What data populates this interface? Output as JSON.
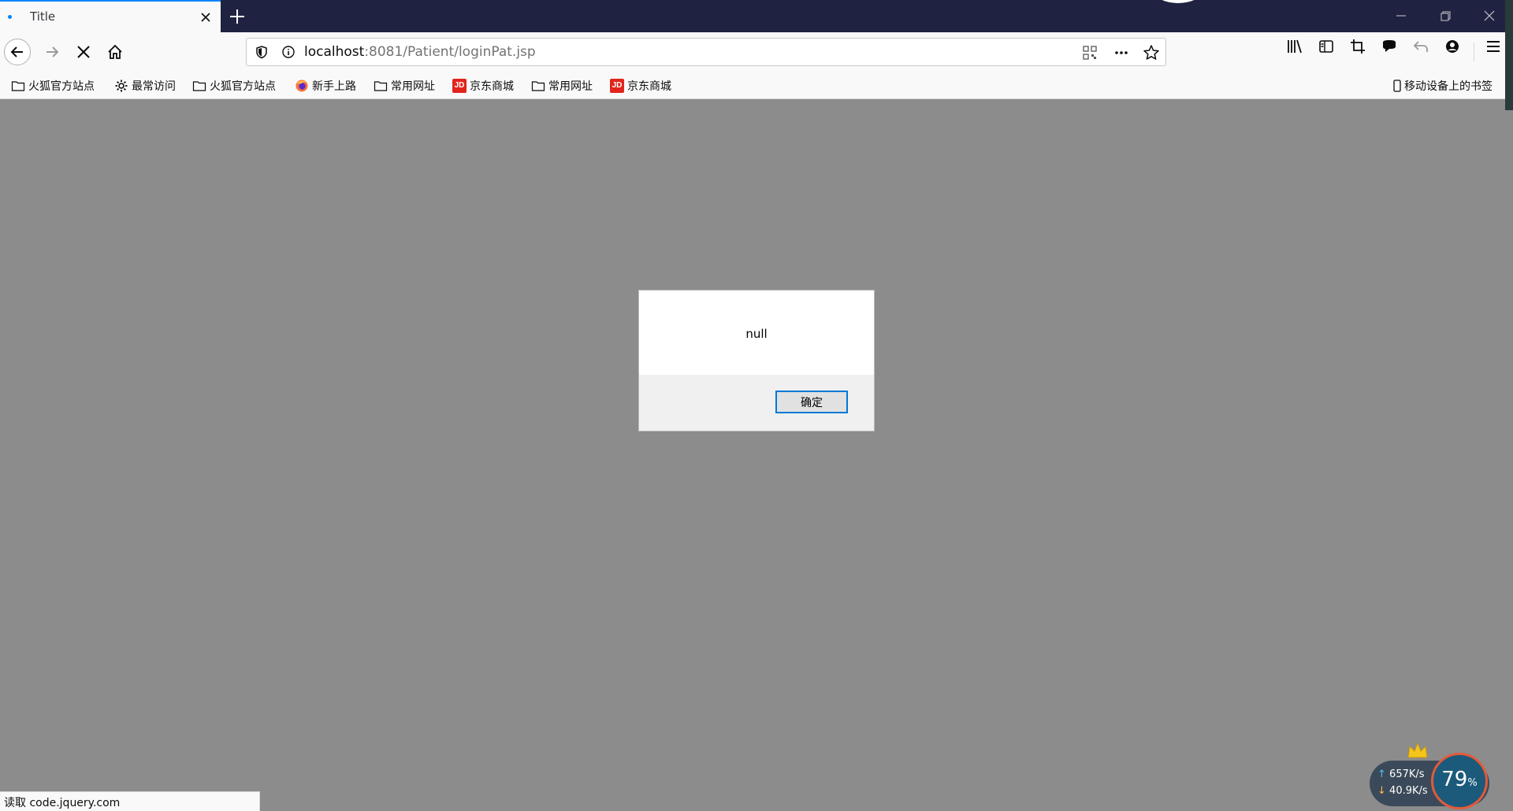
{
  "tab": {
    "title": "Title"
  },
  "urlbar": {
    "host": "localhost",
    "rest": ":8081/Patient/loginPat.jsp"
  },
  "bookmarks": [
    {
      "label": "火狐官方站点",
      "icon": "folder-icon"
    },
    {
      "label": "最常访问",
      "icon": "gear-icon"
    },
    {
      "label": "火狐官方站点",
      "icon": "folder-icon"
    },
    {
      "label": "新手上路",
      "icon": "firefox-icon"
    },
    {
      "label": "常用网址",
      "icon": "folder-icon"
    },
    {
      "label": "京东商城",
      "icon": "jd-icon"
    },
    {
      "label": "常用网址",
      "icon": "folder-icon"
    },
    {
      "label": "京东商城",
      "icon": "jd-icon"
    }
  ],
  "mobile_bookmarks": "移动设备上的书签",
  "jd_logo": "JD",
  "dialog": {
    "message": "null",
    "ok_label": "确定"
  },
  "status": {
    "text": "读取 code.jquery.com"
  },
  "speed": {
    "up": "657K/s",
    "down": "40.9K/s",
    "percent": "79",
    "percent_unit": "%"
  },
  "colors": {
    "accent": "#0a84ff",
    "titlebar": "#1f2341",
    "overlay": "#8c8c8c",
    "jd_red": "#e1251b"
  }
}
